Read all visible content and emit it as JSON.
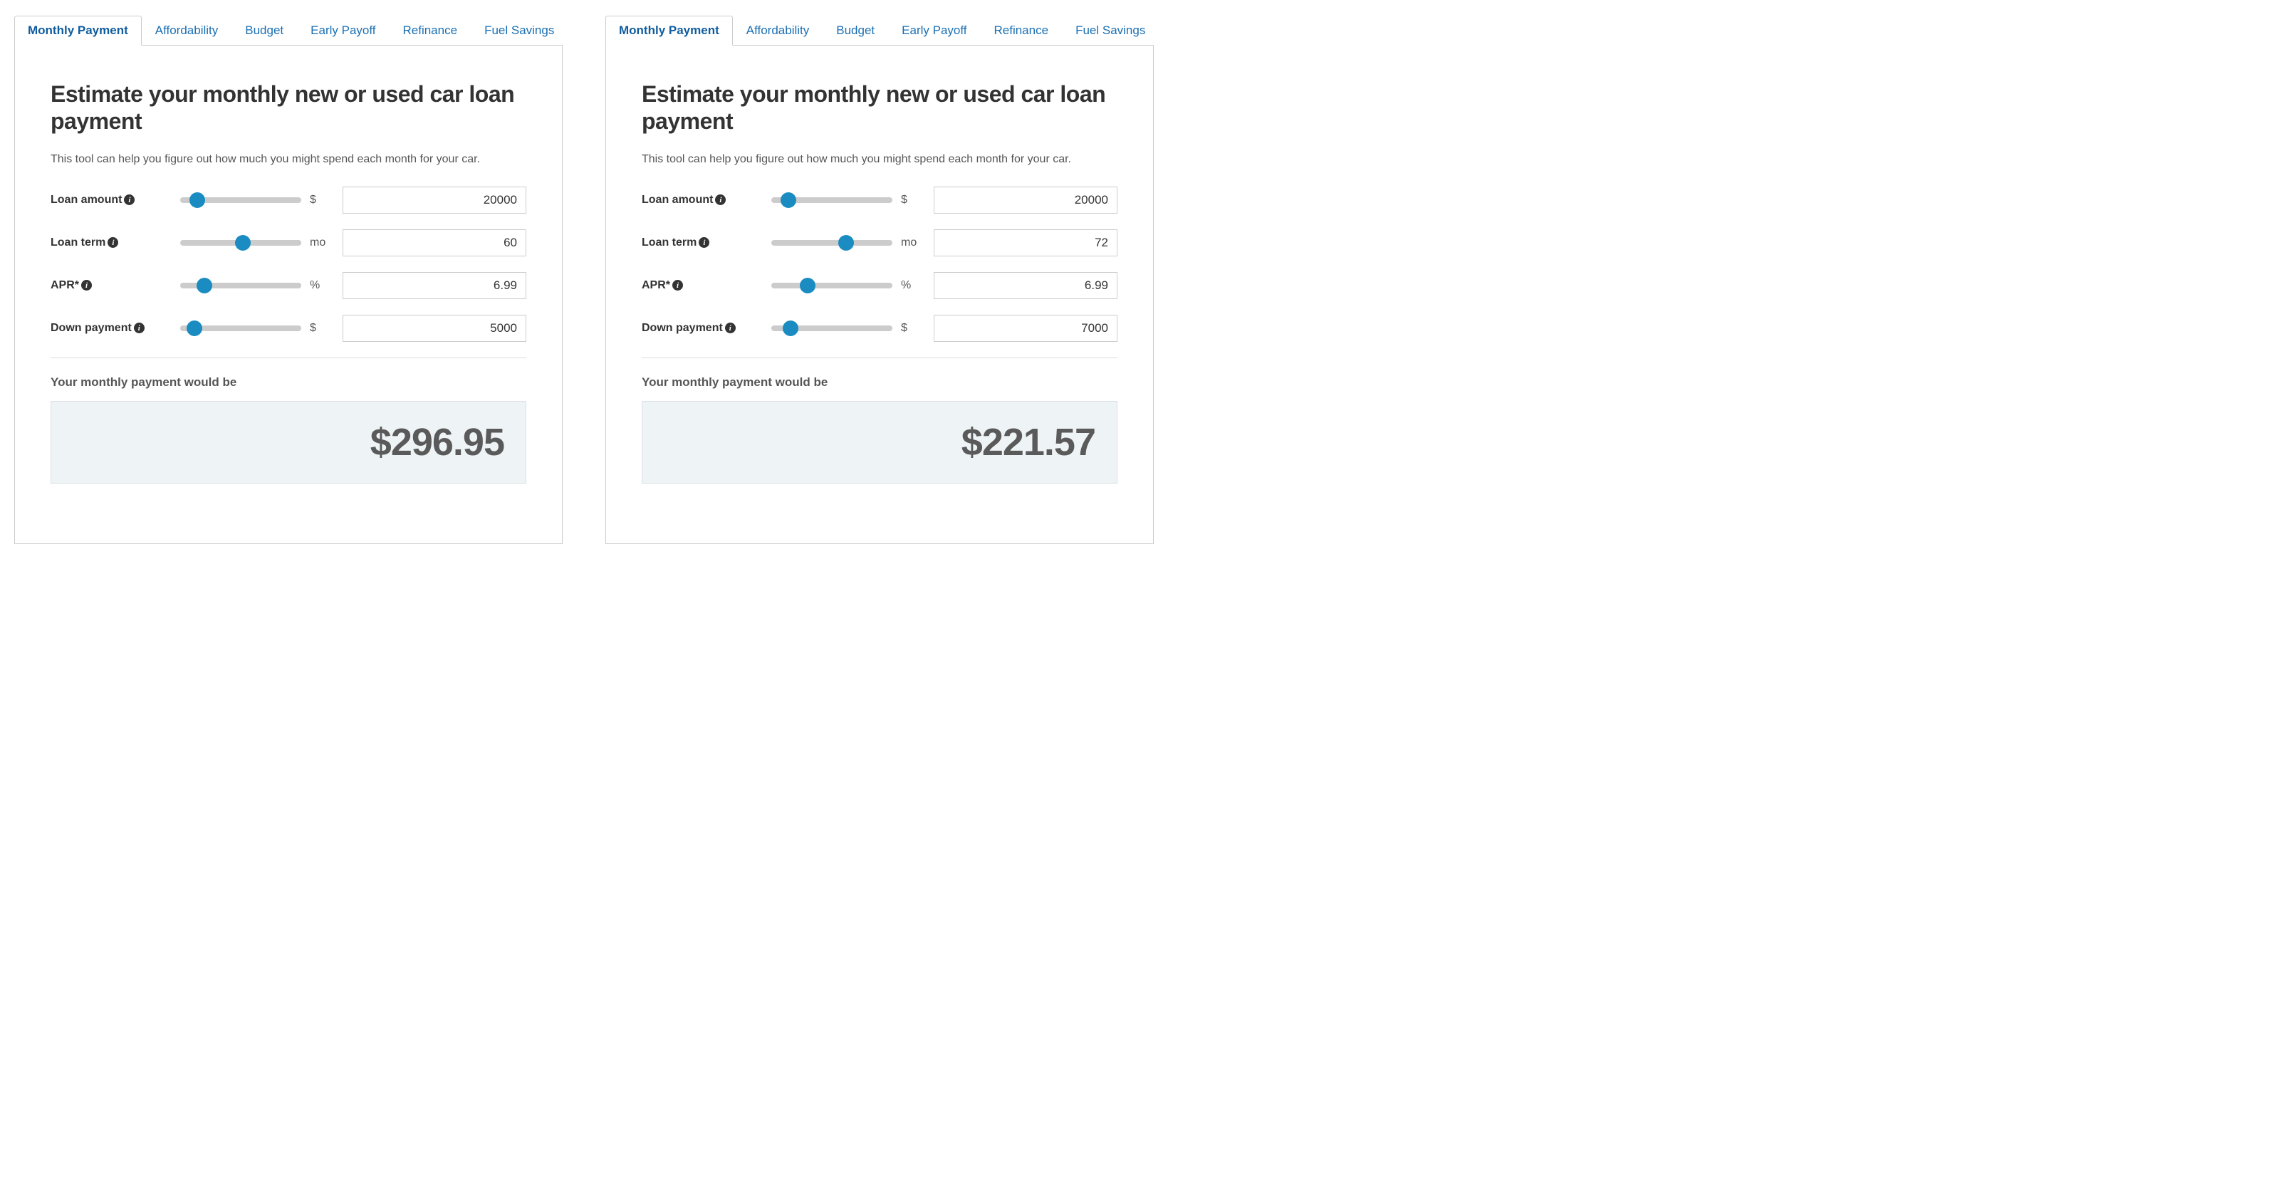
{
  "tabs": [
    "Monthly Payment",
    "Affordability",
    "Budget",
    "Early Payoff",
    "Refinance",
    "Fuel Savings"
  ],
  "heading": "Estimate your monthly new or used car loan payment",
  "subtext": "This tool can help you figure out how much you might spend each month for your car.",
  "labels": {
    "loan_amount": "Loan amount",
    "loan_term": "Loan term",
    "apr": "APR*",
    "down_payment": "Down payment"
  },
  "units": {
    "dollar": "$",
    "month": "mo",
    "percent": "%"
  },
  "result_label": "Your monthly payment would be",
  "calculators": [
    {
      "fields": {
        "loan_amount": {
          "value": "20000",
          "thumb_pct": 14
        },
        "loan_term": {
          "value": "60",
          "thumb_pct": 52
        },
        "apr": {
          "value": "6.99",
          "thumb_pct": 20
        },
        "down_payment": {
          "value": "5000",
          "thumb_pct": 12
        }
      },
      "result": "$296.95"
    },
    {
      "fields": {
        "loan_amount": {
          "value": "20000",
          "thumb_pct": 14
        },
        "loan_term": {
          "value": "72",
          "thumb_pct": 62
        },
        "apr": {
          "value": "6.99",
          "thumb_pct": 30
        },
        "down_payment": {
          "value": "7000",
          "thumb_pct": 16
        }
      },
      "result": "$221.57"
    }
  ]
}
